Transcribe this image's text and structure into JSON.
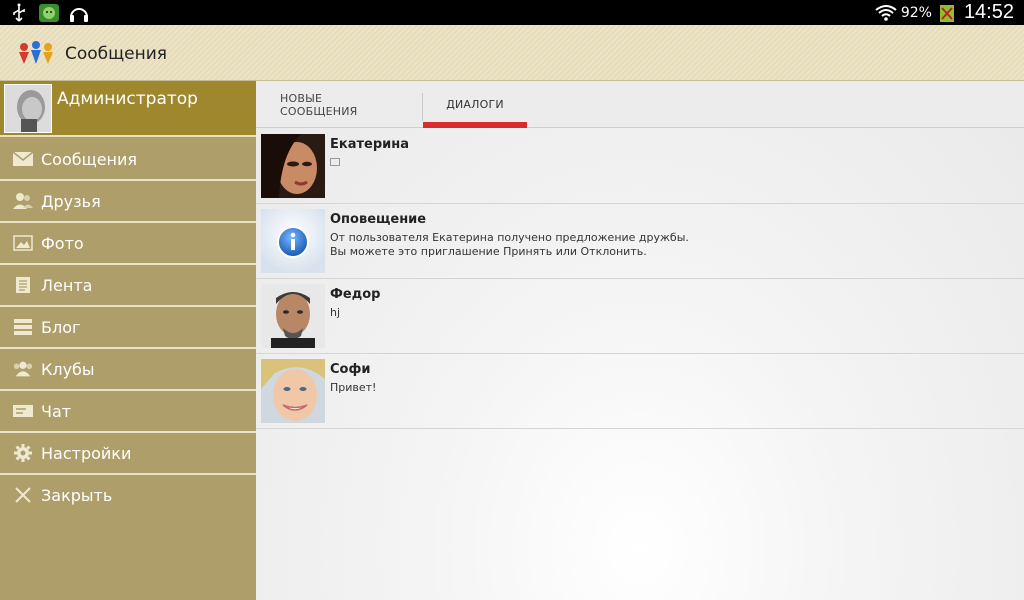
{
  "status_bar": {
    "battery_percent": "92%",
    "time": "14:52"
  },
  "action_bar": {
    "title": "Сообщения"
  },
  "profile": {
    "name": "Администратор"
  },
  "menu": [
    {
      "label": "Сообщения",
      "icon": "envelope-icon"
    },
    {
      "label": "Друзья",
      "icon": "friends-icon"
    },
    {
      "label": "Фото",
      "icon": "photo-icon"
    },
    {
      "label": "Лента",
      "icon": "feed-icon"
    },
    {
      "label": "Блог",
      "icon": "blog-icon"
    },
    {
      "label": "Клубы",
      "icon": "clubs-icon"
    },
    {
      "label": "Чат",
      "icon": "chat-icon"
    },
    {
      "label": "Настройки",
      "icon": "gear-icon"
    },
    {
      "label": "Закрыть",
      "icon": "close-icon"
    }
  ],
  "tabs": {
    "new_messages": "НОВЫЕ СООБЩЕНИЯ",
    "dialogs": "ДИАЛОГИ"
  },
  "dialogs": [
    {
      "name": "Екатерина",
      "text": ""
    },
    {
      "name": "Оповещение",
      "text_line1": "От пользователя Екатерина получено предложение дружбы.",
      "text_line2": "Вы можете это приглашение Принять или Отклонить."
    },
    {
      "name": "Федор",
      "text": "hj"
    },
    {
      "name": "Софи",
      "text": "Привет!"
    }
  ],
  "colors": {
    "accent_red": "#d92b2b",
    "sidebar_bg": "#ad9e6a",
    "profile_bg": "#9e872c"
  }
}
